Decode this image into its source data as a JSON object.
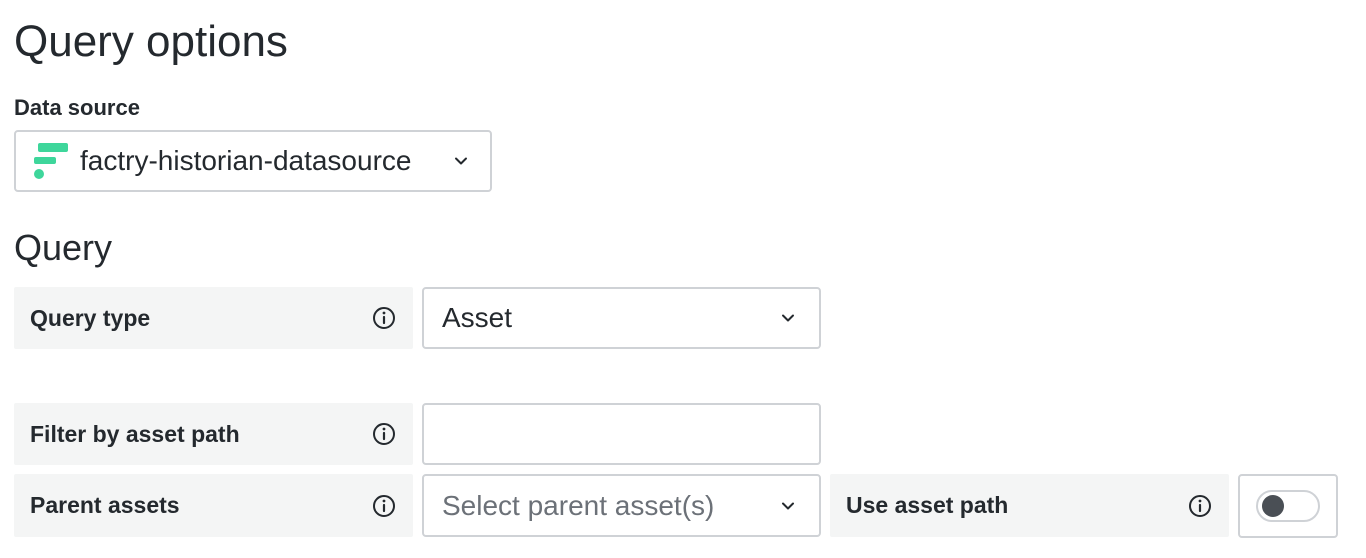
{
  "page": {
    "title": "Query options"
  },
  "datasource": {
    "label": "Data source",
    "value": "factry-historian-datasource",
    "logo_color": "#3ed69b"
  },
  "query": {
    "heading": "Query",
    "query_type": {
      "label": "Query type",
      "value": "Asset"
    },
    "filter_asset_path": {
      "label": "Filter by asset path",
      "value": ""
    },
    "parent_assets": {
      "label": "Parent assets",
      "placeholder": "Select parent asset(s)"
    },
    "use_asset_path": {
      "label": "Use asset path",
      "enabled": false
    }
  },
  "icons": {
    "info": "info-circle-icon",
    "chevron": "chevron-down-icon",
    "logo": "factry-logo-icon"
  }
}
